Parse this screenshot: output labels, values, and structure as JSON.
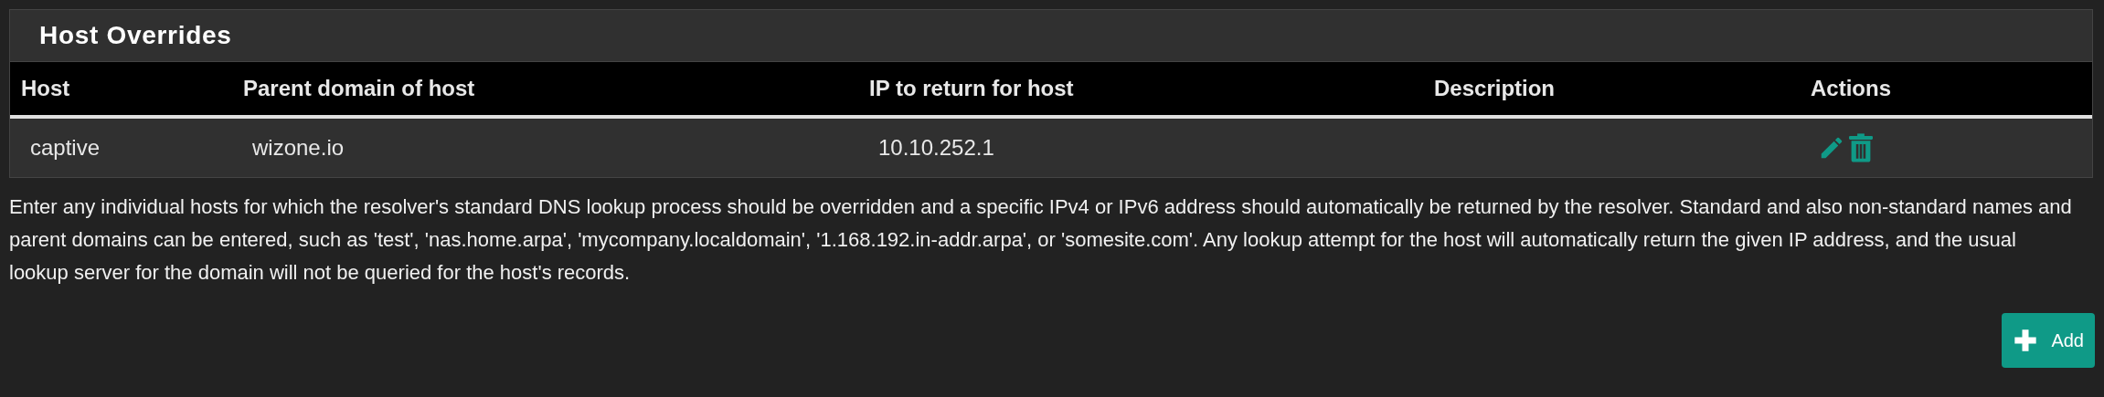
{
  "panel": {
    "title": "Host Overrides"
  },
  "table": {
    "columns": [
      "Host",
      "Parent domain of host",
      "IP to return for host",
      "Description",
      "Actions"
    ],
    "rows": [
      {
        "cells": [
          "captive",
          "wizone.io",
          "10.10.252.1"
        ]
      }
    ]
  },
  "help_text": "Enter any individual hosts for which the resolver's standard DNS lookup process should be overridden and a specific IPv4 or IPv6 address should automatically be returned by the resolver. Standard and also non-standard names and parent domains can be entered, such as 'test', 'nas.home.arpa', 'mycompany.localdomain', '1.168.192.in-addr.arpa', or 'somesite.com'. Any lookup attempt for the host will automatically return the given IP address, and the usual lookup server for the domain will not be queried for the host's records.",
  "add_button": {
    "label": "Add"
  }
}
